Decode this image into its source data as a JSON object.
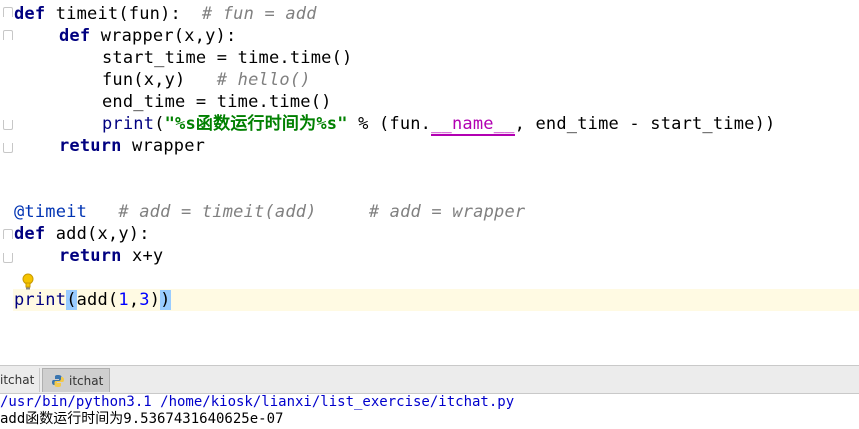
{
  "editor": {
    "lines": [
      {
        "def": "def",
        "rest": " timeit(fun):  ",
        "comment": "# fun = add"
      },
      {
        "def": "def",
        "rest": " wrapper(x,y):"
      },
      {
        "text": "start_time = time.time()"
      },
      {
        "text": "fun(x,y)   ",
        "comment": "# hello()"
      },
      {
        "text": "end_time = time.time()"
      },
      {
        "print": "print",
        "open": "(",
        "string": "\"%s函数运行时间为%s\"",
        "mid": " % (fun.",
        "magic": "__name__",
        "tail": ", end_time - start_time))"
      },
      {
        "kw": "return",
        "rest": " wrapper"
      },
      {
        "deco": "@timeit",
        "comment1": "# add = timeit(add)",
        "comment2": "# add = wrapper"
      },
      {
        "def": "def",
        "rest": " add(x,y):"
      },
      {
        "kw": "return",
        "rest": " x+y"
      },
      {
        "print": "print",
        "open": "(",
        "mid": "add(",
        "n1": "1",
        "comma": ",",
        "n2": "3",
        "close1": ")",
        "close2": ")"
      }
    ]
  },
  "tabs": [
    {
      "label": "itchat"
    },
    {
      "label": "itchat"
    }
  ],
  "console": {
    "command": "/usr/bin/python3.1 /home/kiosk/lianxi/list_exercise/itchat.py",
    "output": "add函数运行时间为9.5367431640625e-07"
  }
}
